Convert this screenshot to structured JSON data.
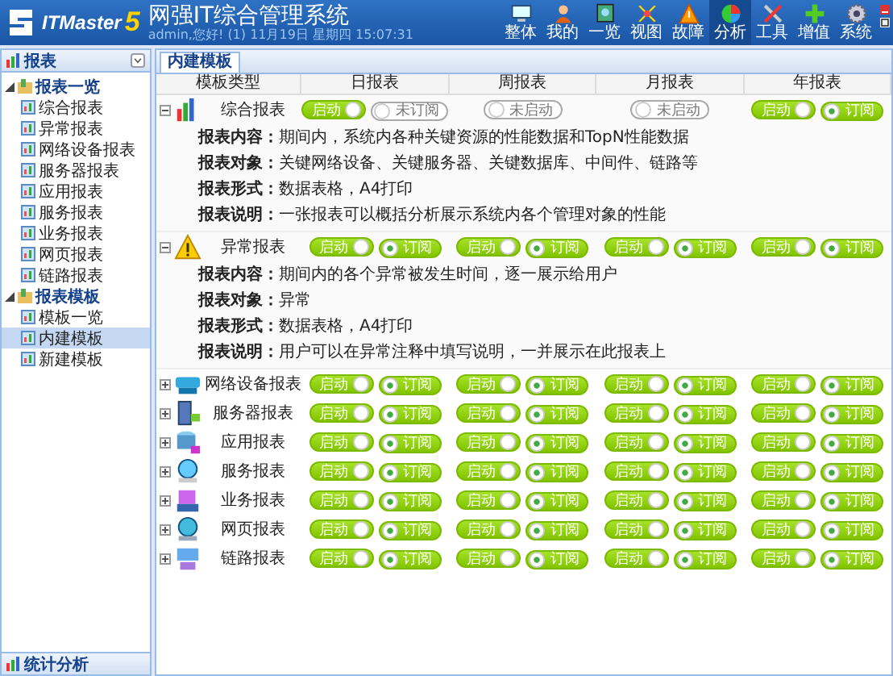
{
  "header": {
    "logo": "ITMaster",
    "version": "5",
    "title": "网强IT综合管理系统",
    "subtitle": "admin,您好! (1) 11月19日 星期四 15:07:31",
    "nav": [
      {
        "label": "整体",
        "selected": false
      },
      {
        "label": "我的",
        "selected": false
      },
      {
        "label": "一览",
        "selected": false
      },
      {
        "label": "视图",
        "selected": false
      },
      {
        "label": "故障",
        "selected": false
      },
      {
        "label": "分析",
        "selected": true
      },
      {
        "label": "工具",
        "selected": false
      },
      {
        "label": "增值",
        "selected": false
      },
      {
        "label": "系统",
        "selected": false
      }
    ]
  },
  "sidebar": {
    "title": "报表",
    "tree": [
      {
        "label": "报表一览",
        "expanded": true,
        "selected": false,
        "children": [
          {
            "label": "综合报表",
            "selected": false
          },
          {
            "label": "异常报表",
            "selected": false
          },
          {
            "label": "网络设备报表",
            "selected": false
          },
          {
            "label": "服务器报表",
            "selected": false
          },
          {
            "label": "应用报表",
            "selected": false
          },
          {
            "label": "服务报表",
            "selected": false
          },
          {
            "label": "业务报表",
            "selected": false
          },
          {
            "label": "网页报表",
            "selected": false
          },
          {
            "label": "链路报表",
            "selected": false
          }
        ]
      },
      {
        "label": "报表模板",
        "expanded": true,
        "selected": false,
        "children": [
          {
            "label": "模板一览",
            "selected": false
          },
          {
            "label": "内建模板",
            "selected": true
          },
          {
            "label": "新建模板",
            "selected": false
          }
        ]
      }
    ],
    "footer": "统计分析"
  },
  "tabs": [
    {
      "label": "内建模板",
      "selected": true
    }
  ],
  "table": {
    "columns": [
      "模板类型",
      "日报表",
      "周报表",
      "月报表",
      "年报表"
    ],
    "rows": [
      {
        "name": "综合报表",
        "expanded": true,
        "details": [
          "**报表内容：**期间内，系统内各种关键资源的性能数据和TopN性能数据",
          "**报表对象：**关键网络设备、关键服务器、关键数据库、中间件、链路等",
          "**报表形式：**数据表格，A4打印",
          "**报表说明：**一张报表可以概括分析展示系统内各个管理对象的性能"
        ],
        "periods": [
          {
            "start": {
              "label": "启动",
              "on": true
            },
            "subscribe": {
              "label": "未订阅",
              "on": false
            }
          },
          {
            "start": {
              "label": "未启动",
              "on": false
            }
          },
          {
            "start": {
              "label": "未启动",
              "on": false
            }
          },
          {
            "start": {
              "label": "启动",
              "on": true
            },
            "subscribe": {
              "label": "订阅",
              "on": true
            }
          }
        ]
      },
      {
        "name": "异常报表",
        "expanded": true,
        "details": [
          "**报表内容：**期间内的各个异常被发生时间，逐一展示给用户",
          "**报表对象：**异常",
          "**报表形式：**数据表格，A4打印",
          "**报表说明：**用户可以在异常注释中填写说明，一并展示在此报表上"
        ],
        "periods": [
          {
            "start": {
              "label": "启动",
              "on": true
            },
            "subscribe": {
              "label": "订阅",
              "on": true
            }
          },
          {
            "start": {
              "label": "启动",
              "on": true
            },
            "subscribe": {
              "label": "订阅",
              "on": true
            }
          },
          {
            "start": {
              "label": "启动",
              "on": true
            },
            "subscribe": {
              "label": "订阅",
              "on": true
            }
          },
          {
            "start": {
              "label": "启动",
              "on": true
            },
            "subscribe": {
              "label": "订阅",
              "on": true
            }
          }
        ]
      },
      {
        "name": "网络设备报表",
        "expanded": false,
        "periods": [
          {
            "start": {
              "label": "启动",
              "on": true
            },
            "subscribe": {
              "label": "订阅",
              "on": true
            }
          },
          {
            "start": {
              "label": "启动",
              "on": true
            },
            "subscribe": {
              "label": "订阅",
              "on": true
            }
          },
          {
            "start": {
              "label": "启动",
              "on": true
            },
            "subscribe": {
              "label": "订阅",
              "on": true
            }
          },
          {
            "start": {
              "label": "启动",
              "on": true
            },
            "subscribe": {
              "label": "订阅",
              "on": true
            }
          }
        ]
      },
      {
        "name": "服务器报表",
        "expanded": false,
        "periods": [
          {
            "start": {
              "label": "启动",
              "on": true
            },
            "subscribe": {
              "label": "订阅",
              "on": true
            }
          },
          {
            "start": {
              "label": "启动",
              "on": true
            },
            "subscribe": {
              "label": "订阅",
              "on": true
            }
          },
          {
            "start": {
              "label": "启动",
              "on": true
            },
            "subscribe": {
              "label": "订阅",
              "on": true
            }
          },
          {
            "start": {
              "label": "启动",
              "on": true
            },
            "subscribe": {
              "label": "订阅",
              "on": true
            }
          }
        ]
      },
      {
        "name": "应用报表",
        "expanded": false,
        "periods": [
          {
            "start": {
              "label": "启动",
              "on": true
            },
            "subscribe": {
              "label": "订阅",
              "on": true
            }
          },
          {
            "start": {
              "label": "启动",
              "on": true
            },
            "subscribe": {
              "label": "订阅",
              "on": true
            }
          },
          {
            "start": {
              "label": "启动",
              "on": true
            },
            "subscribe": {
              "label": "订阅",
              "on": true
            }
          },
          {
            "start": {
              "label": "启动",
              "on": true
            },
            "subscribe": {
              "label": "订阅",
              "on": true
            }
          }
        ]
      },
      {
        "name": "服务报表",
        "expanded": false,
        "periods": [
          {
            "start": {
              "label": "启动",
              "on": true
            },
            "subscribe": {
              "label": "订阅",
              "on": true
            }
          },
          {
            "start": {
              "label": "启动",
              "on": true
            },
            "subscribe": {
              "label": "订阅",
              "on": true
            }
          },
          {
            "start": {
              "label": "启动",
              "on": true
            },
            "subscribe": {
              "label": "订阅",
              "on": true
            }
          },
          {
            "start": {
              "label": "启动",
              "on": true
            },
            "subscribe": {
              "label": "订阅",
              "on": true
            }
          }
        ]
      },
      {
        "name": "业务报表",
        "expanded": false,
        "periods": [
          {
            "start": {
              "label": "启动",
              "on": true
            },
            "subscribe": {
              "label": "订阅",
              "on": true
            }
          },
          {
            "start": {
              "label": "启动",
              "on": true
            },
            "subscribe": {
              "label": "订阅",
              "on": true
            }
          },
          {
            "start": {
              "label": "启动",
              "on": true
            },
            "subscribe": {
              "label": "订阅",
              "on": true
            }
          },
          {
            "start": {
              "label": "启动",
              "on": true
            },
            "subscribe": {
              "label": "订阅",
              "on": true
            }
          }
        ]
      },
      {
        "name": "网页报表",
        "expanded": false,
        "periods": [
          {
            "start": {
              "label": "启动",
              "on": true
            },
            "subscribe": {
              "label": "订阅",
              "on": true
            }
          },
          {
            "start": {
              "label": "启动",
              "on": true
            },
            "subscribe": {
              "label": "订阅",
              "on": true
            }
          },
          {
            "start": {
              "label": "启动",
              "on": true
            },
            "subscribe": {
              "label": "订阅",
              "on": true
            }
          },
          {
            "start": {
              "label": "启动",
              "on": true
            },
            "subscribe": {
              "label": "订阅",
              "on": true
            }
          }
        ]
      },
      {
        "name": "链路报表",
        "expanded": false,
        "periods": [
          {
            "start": {
              "label": "启动",
              "on": true
            },
            "subscribe": {
              "label": "订阅",
              "on": true
            }
          },
          {
            "start": {
              "label": "启动",
              "on": true
            },
            "subscribe": {
              "label": "订阅",
              "on": true
            }
          },
          {
            "start": {
              "label": "启动",
              "on": true
            },
            "subscribe": {
              "label": "订阅",
              "on": true
            }
          },
          {
            "start": {
              "label": "启动",
              "on": true
            },
            "subscribe": {
              "label": "订阅",
              "on": true
            }
          }
        ]
      }
    ]
  }
}
